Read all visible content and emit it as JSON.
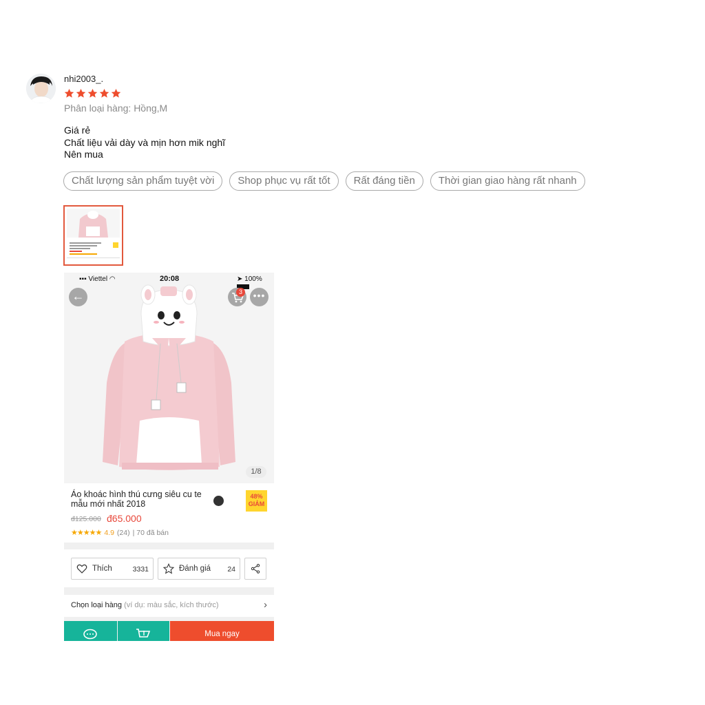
{
  "review": {
    "username": "nhi2003_.",
    "rating": 5,
    "variant": "Phân loại hàng: Hồng,M",
    "comment_lines": [
      "Giá rẻ",
      "Chất liệu vải dày và mịn hơn mik nghĩ",
      "Nên mua"
    ],
    "tags": [
      "Chất lượng sản phẩm tuyệt vời",
      "Shop phục vụ rất tốt",
      "Rất đáng tiền",
      "Thời gian giao hàng rất nhanh"
    ]
  },
  "screenshot": {
    "status": {
      "carrier": "Viettel",
      "time": "20:08",
      "battery": "100%"
    },
    "cart_count": "3",
    "image_counter": "1/8",
    "product_title": "Áo khoác hình thú cưng siêu cu te mẫu mới nhất 2018",
    "discount": "48%",
    "discount_label": "GIẢM",
    "old_price": "đ125.000",
    "new_price": "đ65.000",
    "stars": "★★★★★",
    "rating_value": "4.9",
    "rating_count": "(24)",
    "sold": "| 70 đã bán",
    "like_label": "Thích",
    "like_count": "3331",
    "review_label": "Đánh giá",
    "review_count": "24",
    "variant_label": "Chọn loại hàng",
    "variant_hint": "(ví dụ: màu sắc, kích thước)",
    "buy_label": "Mua ngay"
  },
  "colors": {
    "star": "#ee4d2d",
    "price": "#e8473a",
    "thumb_border": "#e2583c",
    "teal": "#16b49a",
    "buy": "#ee4d2d"
  }
}
